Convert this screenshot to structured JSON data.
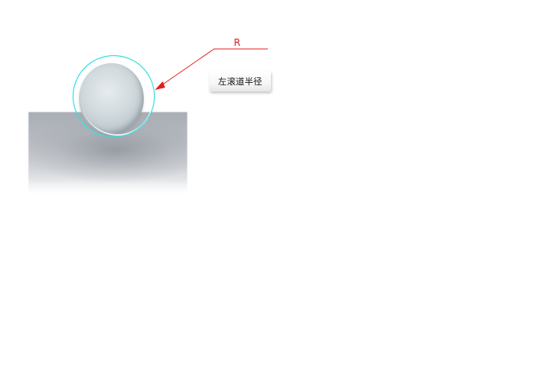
{
  "diagram": {
    "radius_symbol": "R",
    "callout_label": "左滚道半径",
    "colors": {
      "annotation": "#e02020",
      "circle_outline": "#33e0e0",
      "callout_background": "#f5f5f5"
    }
  }
}
